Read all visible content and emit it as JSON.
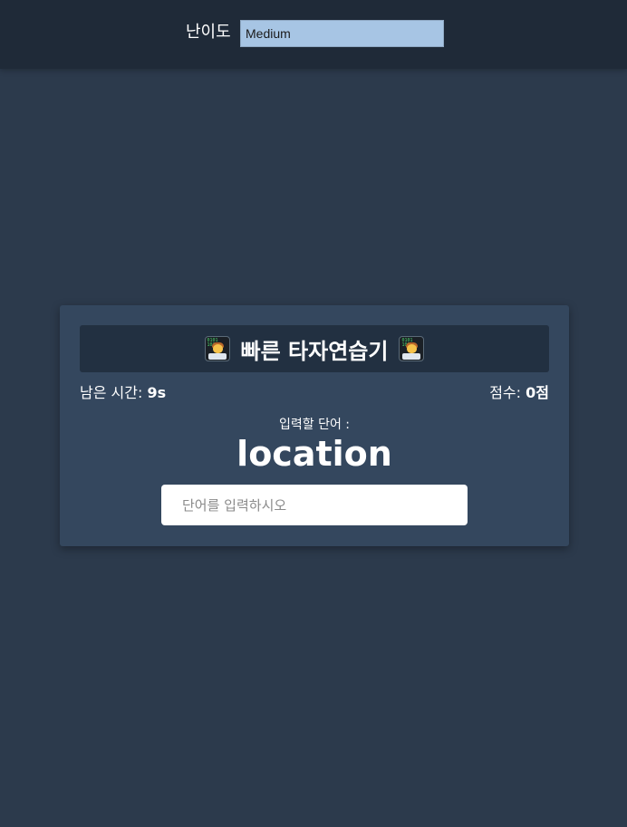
{
  "topbar": {
    "difficulty_label": "난이도",
    "difficulty_selected": "Medium"
  },
  "card": {
    "title": "빠른 타자연습기",
    "title_icon": "technologist-emoji-icon",
    "time_label": "남은 시간:",
    "time_value": "9s",
    "score_label": "점수:",
    "score_value": "0점",
    "prompt_label": "입력할 단어 :",
    "target_word": "location",
    "input_placeholder": "단어를 입력하시오",
    "input_value": ""
  },
  "colors": {
    "page_background": "#2c3a4c",
    "topbar_background": "#1f2a38",
    "card_background": "#34475e",
    "header_background": "#223041",
    "select_background": "#a7c5e4",
    "input_background": "#ffffff"
  }
}
